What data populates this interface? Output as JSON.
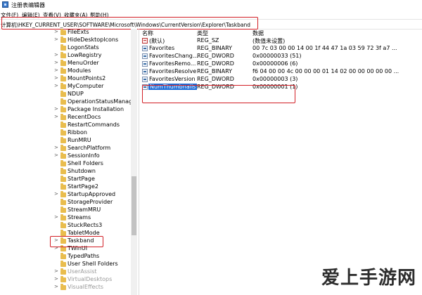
{
  "window": {
    "title": "注册表编辑器",
    "icon": "registry-editor-icon"
  },
  "menu": [
    "文件(F)",
    "编辑(E)",
    "查看(V)",
    "收藏夹(A)",
    "帮助(H)"
  ],
  "address": "计算机\\HKEY_CURRENT_USER\\SOFTWARE\\Microsoft\\Windows\\CurrentVersion\\Explorer\\Taskband",
  "tree": [
    {
      "label": "FileExts",
      "chevron": ">"
    },
    {
      "label": "HideDesktopIcons",
      "chevron": ">"
    },
    {
      "label": "LogonStats",
      "chevron": ""
    },
    {
      "label": "LowRegistry",
      "chevron": ">"
    },
    {
      "label": "MenuOrder",
      "chevron": ">"
    },
    {
      "label": "Modules",
      "chevron": ">"
    },
    {
      "label": "MountPoints2",
      "chevron": ">"
    },
    {
      "label": "MyComputer",
      "chevron": ">"
    },
    {
      "label": "NDUP",
      "chevron": ""
    },
    {
      "label": "OperationStatusManage",
      "chevron": ""
    },
    {
      "label": "Package Installation",
      "chevron": ">"
    },
    {
      "label": "RecentDocs",
      "chevron": ">"
    },
    {
      "label": "RestartCommands",
      "chevron": ""
    },
    {
      "label": "Ribbon",
      "chevron": ""
    },
    {
      "label": "RunMRU",
      "chevron": ""
    },
    {
      "label": "SearchPlatform",
      "chevron": ">"
    },
    {
      "label": "SessionInfo",
      "chevron": ">"
    },
    {
      "label": "Shell Folders",
      "chevron": ""
    },
    {
      "label": "Shutdown",
      "chevron": ""
    },
    {
      "label": "StartPage",
      "chevron": ""
    },
    {
      "label": "StartPage2",
      "chevron": ""
    },
    {
      "label": "StartupApproved",
      "chevron": ">"
    },
    {
      "label": "StorageProvider",
      "chevron": ""
    },
    {
      "label": "StreamMRU",
      "chevron": ""
    },
    {
      "label": "Streams",
      "chevron": ">"
    },
    {
      "label": "StuckRects3",
      "chevron": ""
    },
    {
      "label": "TabletMode",
      "chevron": ""
    },
    {
      "label": "Taskband",
      "chevron": ">",
      "selected": true
    },
    {
      "label": "TWinUI",
      "chevron": ">"
    },
    {
      "label": "TypedPaths",
      "chevron": ""
    },
    {
      "label": "User Shell Folders",
      "chevron": ""
    },
    {
      "label": "UserAssist",
      "chevron": ">",
      "faded": true
    },
    {
      "label": "VirtualDesktops",
      "chevron": ">",
      "faded": true
    },
    {
      "label": "VisualEffects",
      "chevron": ">",
      "faded": true
    }
  ],
  "columns": {
    "name": "名称",
    "type": "类型",
    "data": "数据"
  },
  "values": [
    {
      "name": "(默认)",
      "type": "REG_SZ",
      "data": "(数值未设置)",
      "icon": "string-value-icon"
    },
    {
      "name": "Favorites",
      "type": "REG_BINARY",
      "data": "00 7c 03 00 00 14 00 1f 44 47 1a 03 59 72 3f a7 ...",
      "icon": "binary-value-icon"
    },
    {
      "name": "FavoritesChang...",
      "type": "REG_DWORD",
      "data": "0x00000033 (51)",
      "icon": "binary-value-icon"
    },
    {
      "name": "FavoritesRemo...",
      "type": "REG_DWORD",
      "data": "0x00000006 (6)",
      "icon": "binary-value-icon"
    },
    {
      "name": "FavoritesResolve",
      "type": "REG_BINARY",
      "data": "f6 04 00 00 4c 00 00 00 01 14 02 00 00 00 00 00 ...",
      "icon": "binary-value-icon"
    },
    {
      "name": "FavoritesVersion",
      "type": "REG_DWORD",
      "data": "0x00000003 (3)",
      "icon": "binary-value-icon"
    },
    {
      "name": "NumThumbnails",
      "type": "REG_DWORD",
      "data": "0x00000001 (1)",
      "icon": "binary-value-icon",
      "selected": true
    }
  ],
  "watermark": "爱上手游网",
  "colors": {
    "highlight_border": "#d21f26",
    "selection": "#1b6ad6",
    "folder": "#e9bd4e"
  }
}
